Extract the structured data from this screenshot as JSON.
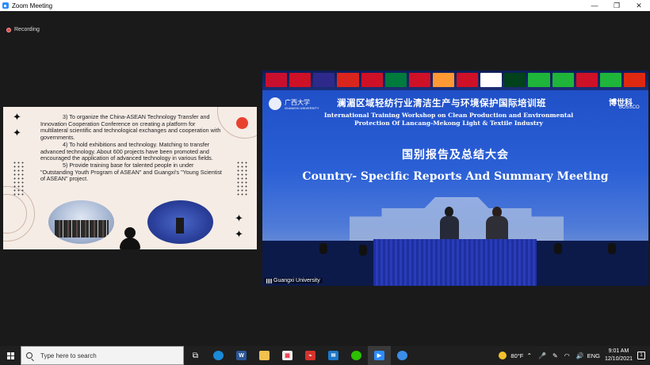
{
  "window": {
    "title": "Zoom Meeting",
    "minimize": "—",
    "maximize": "❐",
    "close": "✕"
  },
  "recording": {
    "label": "Recording"
  },
  "shared_content": {
    "paragraphs": [
      "3) To organize the China-ASEAN Technology Transfer and Innovation Cooperation Conference on creating a platform for multilateral scientific and technological exchanges and cooperation with governments.",
      "4) To hold exhibitions and technology. Matching to transfer advanced technology. About 600 projects have been promoted and encouraged the application of advanced technology in various fields.",
      "5) Provide training base for talented people in under \"Outstanding Youth Program of ASEAN\" and Guangxi's \"Young Scientist of ASEAN\" project."
    ],
    "accent_color": "#e8422f"
  },
  "video": {
    "participant_name": "Guangxi University",
    "banner": {
      "university_logo_text": "广西大学",
      "university_logo_sub": "GUANGXI UNIVERSITY",
      "title_zh": "澜湄区域轻纺行业清洁生产与环境保护国际培训班",
      "sponsor_logo": "博世科",
      "sponsor_sub": "BOSSCO",
      "title_en_line1": "International Training Workshop on Clean Production and Environmental",
      "title_en_line2": "Protection Of Lancang-Mekong  Light & Textile Industry",
      "meeting_zh": "国别报告及总结大会",
      "meeting_en": "Country- Specific Reports And Summary Meeting"
    },
    "flags": [
      "#c8102e",
      "#ce1126",
      "#2d2a8c",
      "#da251d",
      "#ce1126",
      "#007a3d",
      "#ce1126",
      "#ff9933",
      "#ce1126",
      "#ffffff",
      "#01411c",
      "#1eb53a",
      "#1eb53a",
      "#ce1126",
      "#1eb53a",
      "#de2910"
    ]
  },
  "taskbar": {
    "search_placeholder": "Type here to search",
    "apps": [
      "task-view",
      "edge",
      "word",
      "file-explorer",
      "store",
      "acrobat",
      "mail",
      "wechat",
      "zoom",
      "app"
    ],
    "weather": "80°F",
    "language": "ENG",
    "time": "9:01 AM",
    "date": "12/10/2021",
    "notifications": "1"
  }
}
